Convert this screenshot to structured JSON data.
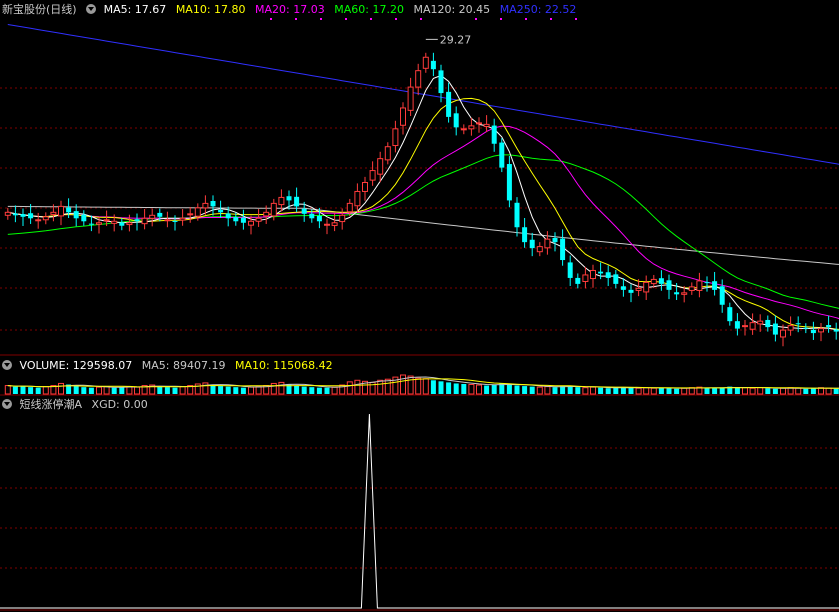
{
  "title": "新宝股份(日线)",
  "ma_legend": [
    {
      "label": "MA5: 17.67",
      "color": "#ffffff"
    },
    {
      "label": "MA10: 17.80",
      "color": "#ffff00"
    },
    {
      "label": "MA20: 17.03",
      "color": "#ff00ff"
    },
    {
      "label": "MA60: 17.20",
      "color": "#00ff00"
    },
    {
      "label": "MA120: 20.45",
      "color": "#c8c8c8"
    },
    {
      "label": "MA250: 22.52",
      "color": "#3030ff"
    }
  ],
  "peak_label": "29.27",
  "volume_legend": [
    {
      "label": "VOLUME: 129598.07",
      "color": "#ffffff"
    },
    {
      "label": "MA5: 89407.19",
      "color": "#c8c8c8"
    },
    {
      "label": "MA10: 115068.42",
      "color": "#ffff00"
    }
  ],
  "indicator_title": "短线涨停潮A",
  "indicator_legend": "XGD: 0.00",
  "colors": {
    "up": "#ff3c3c",
    "down": "#00ffff",
    "grid": "#800000",
    "axis": "#800000"
  },
  "chart_data": {
    "type": "candlestick",
    "closes": [
      17.6,
      17.4,
      17.3,
      17.2,
      17.1,
      17.3,
      17.6,
      18.0,
      17.6,
      17.2,
      17.0,
      16.8,
      16.9,
      17.1,
      17.0,
      16.7,
      16.9,
      17.0,
      17.2,
      17.4,
      17.3,
      17.1,
      17.0,
      17.2,
      17.5,
      17.9,
      18.2,
      18.0,
      17.6,
      17.2,
      17.0,
      16.9,
      17.0,
      17.2,
      17.6,
      18.2,
      18.6,
      18.4,
      18.0,
      17.5,
      17.2,
      17.0,
      16.8,
      16.9,
      17.4,
      18.2,
      19.0,
      19.6,
      20.4,
      21.2,
      22.0,
      23.2,
      24.6,
      26.0,
      27.1,
      28.0,
      27.2,
      25.6,
      24.0,
      23.3,
      23.2,
      23.4,
      23.6,
      23.5,
      22.2,
      20.6,
      18.4,
      16.6,
      15.6,
      15.2,
      15.3,
      15.8,
      15.6,
      14.4,
      13.2,
      12.8,
      13.4,
      13.7,
      13.5,
      13.2,
      12.8,
      12.4,
      12.2,
      12.5,
      12.9,
      13.1,
      12.8,
      12.4,
      12.1,
      12.2,
      12.6,
      13.0,
      12.9,
      12.4,
      11.4,
      10.3,
      9.8,
      10.0,
      10.2,
      10.3,
      9.9,
      9.4,
      9.7,
      10.0,
      10.1,
      9.8,
      9.5,
      9.8,
      9.9,
      9.6,
      9.4,
      9.5,
      9.7
    ],
    "volumes": [
      1.6,
      1.4,
      1.5,
      1.3,
      1.2,
      1.4,
      1.6,
      2.0,
      1.8,
      1.5,
      1.3,
      1.2,
      1.3,
      1.4,
      1.2,
      1.3,
      1.4,
      1.3,
      1.6,
      1.7,
      1.5,
      1.3,
      1.2,
      1.4,
      1.6,
      1.9,
      2.1,
      1.8,
      1.5,
      1.4,
      1.3,
      1.2,
      1.3,
      1.4,
      1.6,
      2.0,
      2.2,
      1.9,
      1.6,
      1.4,
      1.3,
      1.2,
      1.2,
      1.3,
      1.7,
      2.3,
      2.6,
      2.4,
      2.2,
      2.6,
      2.8,
      3.2,
      3.6,
      3.4,
      3.0,
      2.9,
      2.6,
      2.4,
      2.2,
      2.0,
      1.9,
      1.8,
      1.7,
      1.6,
      1.8,
      2.0,
      1.9,
      1.6,
      1.5,
      1.4,
      1.3,
      1.4,
      1.3,
      1.5,
      1.6,
      1.3,
      1.2,
      1.3,
      1.2,
      1.1,
      1.2,
      1.3,
      1.2,
      1.1,
      1.2,
      1.1,
      1.2,
      1.1,
      1.0,
      1.1,
      1.2,
      1.3,
      1.2,
      1.1,
      1.2,
      1.4,
      1.3,
      1.2,
      1.1,
      1.2,
      1.1,
      1.0,
      1.1,
      1.2,
      1.1,
      1.0,
      1.1,
      1.2,
      1.1,
      1.0,
      1.1,
      1.2,
      1.3
    ],
    "indicator": {
      "spike_index": 51,
      "spike_value": 1
    }
  }
}
